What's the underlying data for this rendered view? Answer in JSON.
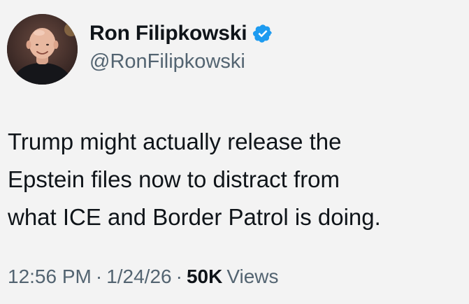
{
  "author": {
    "display_name": "Ron Filipkowski",
    "handle": "@RonFilipkowski",
    "verified": true,
    "avatar_icon": "profile-photo"
  },
  "tweet": {
    "lines": [
      "Trump might actually release the",
      "Epstein files now to distract from",
      "what ICE and Border Patrol is doing."
    ]
  },
  "meta": {
    "time": "12:56 PM",
    "separator": "·",
    "date": "1/24/26",
    "views_count": "50K",
    "views_label": "Views"
  },
  "colors": {
    "background": "#f3f3f3",
    "primary_text": "#0f1419",
    "secondary_text": "#536471",
    "verified_blue": "#1d9bf0"
  }
}
